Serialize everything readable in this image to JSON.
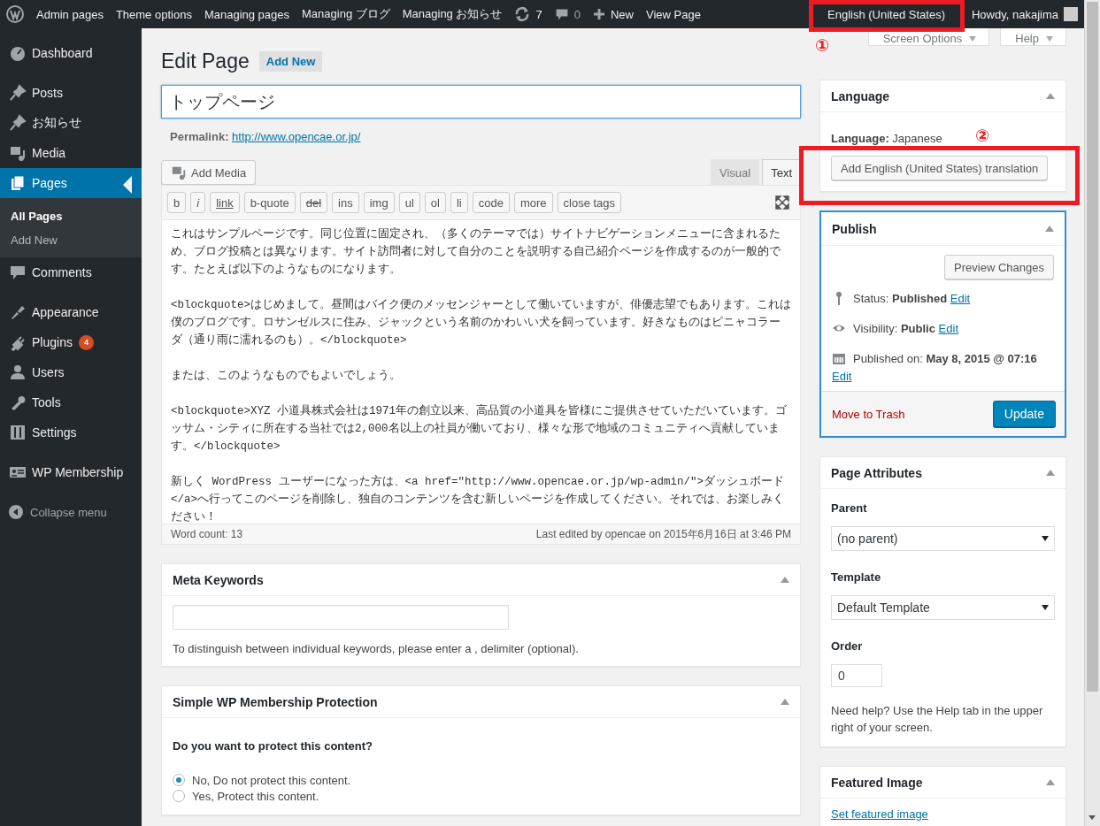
{
  "admin_bar": {
    "site_menus": [
      {
        "label": "Admin pages"
      },
      {
        "label": "Theme options"
      },
      {
        "label": "Managing pages"
      },
      {
        "label": "Managing ブログ"
      },
      {
        "label": "Managing お知らせ"
      }
    ],
    "updates": "7",
    "comments": "0",
    "new_label": "New",
    "view_label": "View Page",
    "language": "English (United States)",
    "greeting": "Howdy, nakajima"
  },
  "annotations": [
    "①",
    "②"
  ],
  "screen_tabs": [
    {
      "label": "Screen Options"
    },
    {
      "label": "Help"
    }
  ],
  "sidebar": {
    "groups": [
      {
        "items": [
          {
            "label": "Dashboard",
            "selected": false
          }
        ]
      },
      {
        "items": [
          {
            "label": "Posts",
            "selected": false
          },
          {
            "label": "お知らせ",
            "selected": false
          },
          {
            "label": "Media",
            "selected": false
          },
          {
            "label": "Pages",
            "selected": true,
            "children": [
              {
                "label": "All Pages",
                "selected": true
              },
              {
                "label": "Add New",
                "selected": false
              }
            ]
          },
          {
            "label": "Comments",
            "selected": false
          }
        ]
      },
      {
        "items": [
          {
            "label": "Appearance",
            "selected": false
          },
          {
            "label": "Plugins",
            "selected": false,
            "badge": "4"
          },
          {
            "label": "Users",
            "selected": false
          },
          {
            "label": "Tools",
            "selected": false
          },
          {
            "label": "Settings",
            "selected": false
          }
        ]
      },
      {
        "items": [
          {
            "label": "WP Membership",
            "selected": false
          }
        ]
      }
    ],
    "collapse": "Collapse menu"
  },
  "heading": {
    "title": "Edit Page",
    "add_new": "Add New"
  },
  "title_field": {
    "value": "トップページ"
  },
  "permalink": {
    "label": "Permalink:",
    "url": "http://www.opencae.or.jp/"
  },
  "editor": {
    "add_media": "Add Media",
    "tabs": [
      {
        "label": "Visual",
        "selected": false
      },
      {
        "label": "Text",
        "selected": true
      }
    ],
    "quicktags": [
      {
        "label": "b",
        "kind": "bold"
      },
      {
        "label": "i",
        "kind": "italic"
      },
      {
        "label": "link",
        "kind": "link"
      },
      {
        "label": "b-quote",
        "kind": "plain"
      },
      {
        "label": "del",
        "kind": "del"
      },
      {
        "label": "ins",
        "kind": "plain"
      },
      {
        "label": "img",
        "kind": "plain"
      },
      {
        "label": "ul",
        "kind": "plain"
      },
      {
        "label": "ol",
        "kind": "plain"
      },
      {
        "label": "li",
        "kind": "plain"
      },
      {
        "label": "code",
        "kind": "plain"
      },
      {
        "label": "more",
        "kind": "plain"
      },
      {
        "label": "close tags",
        "kind": "plain"
      }
    ],
    "paragraphs": [
      "これはサンプルページです。同じ位置に固定され、（多くのテーマでは）サイトナビゲーションメニューに含まれるため、ブログ投稿とは異なります。サイト訪問者に対して自分のことを説明する自己紹介ページを作成するのが一般的です。たとえば以下のようなものになります。",
      "<blockquote>はじめまして。昼間はバイク便のメッセンジャーとして働いていますが、俳優志望でもあります。これは僕のブログです。ロサンゼルスに住み、ジャックという名前のかわいい犬を飼っています。好きなものはピニャコラーダ（通り雨に濡れるのも）。</blockquote>",
      "または、このようなものでもよいでしょう。",
      "<blockquote>XYZ 小道具株式会社は1971年の創立以来、高品質の小道具を皆様にご提供させていただいています。ゴッサム・シティに所在する当社では2,000名以上の社員が働いており、様々な形で地域のコミュニティへ貢献しています。</blockquote>",
      "新しく WordPress ユーザーになった方は、<a href=\"http://www.opencae.or.jp/wp-admin/\">ダッシュボード</a>へ行ってこのページを削除し、独自のコンテンツを含む新しいページを作成してください。それでは、お楽しみください！"
    ],
    "word_count": "Word count: 13",
    "last_edited": "Last edited by opencae on 2015年6月16日 at 3:46 PM"
  },
  "meta_keywords": {
    "title": "Meta Keywords",
    "help": "To distinguish between individual keywords, please enter a , delimiter (optional)."
  },
  "membership": {
    "title": "Simple WP Membership Protection",
    "question": "Do you want to protect this content?",
    "options": [
      {
        "label": "No, Do not protect this content.",
        "selected": true
      },
      {
        "label": "Yes, Protect this content.",
        "selected": false
      }
    ]
  },
  "language_box": {
    "title": "Language",
    "current": "**Language:** Japanese",
    "button": "Add English (United States) translation"
  },
  "publish": {
    "title": "Publish",
    "preview": "Preview Changes",
    "rows": [
      {
        "text": "Status: **Published**",
        "link": "Edit"
      },
      {
        "text": "Visibility: **Public**",
        "link": "Edit"
      },
      {
        "text": "Published on: **May 8, 2015 @ 07:16**",
        "link": "Edit"
      }
    ],
    "trash": "Move to Trash",
    "update": "Update"
  },
  "page_attributes": {
    "title": "Page Attributes",
    "parent_label": "Parent",
    "parent": "(no parent)",
    "template_label": "Template",
    "template": "Default Template",
    "order_label": "Order",
    "order": "0",
    "help": "Need help? Use the Help tab in the upper right of your screen."
  },
  "featured_image": {
    "title": "Featured Image",
    "link": "Set featured image"
  }
}
